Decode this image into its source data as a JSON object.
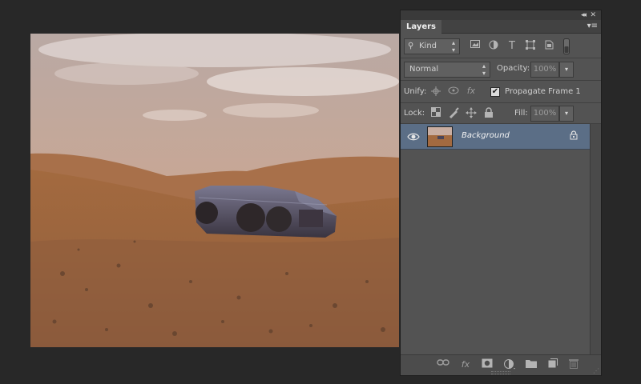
{
  "panel": {
    "tab_label": "Layers",
    "collapse_label": "◂◂",
    "close_label": "✕",
    "menu_label": "▾≡"
  },
  "filter": {
    "kind_label": "Kind",
    "icons": [
      "pixel-filter-icon",
      "adjustment-filter-icon",
      "type-filter-icon",
      "shape-filter-icon",
      "smart-object-filter-icon",
      "filter-toggle-icon"
    ]
  },
  "blend": {
    "mode": "Normal",
    "opacity_label": "Opacity:",
    "opacity_value": "100%"
  },
  "unify": {
    "label": "Unify:",
    "propagate_label": "Propagate Frame 1",
    "propagate_checked": "✔"
  },
  "lock": {
    "label": "Lock:",
    "fill_label": "Fill:",
    "fill_value": "100%"
  },
  "layers": [
    {
      "name": "Background",
      "visible": true,
      "locked": true
    }
  ],
  "footer": {
    "icons": [
      "link-layers-icon",
      "fx-icon",
      "add-mask-icon",
      "adjustment-layer-icon",
      "new-group-icon",
      "new-layer-icon",
      "delete-layer-icon"
    ]
  },
  "colors": {
    "panel_bg": "#535353",
    "selected_layer": "#5b6e86",
    "app_bg": "#282828"
  }
}
